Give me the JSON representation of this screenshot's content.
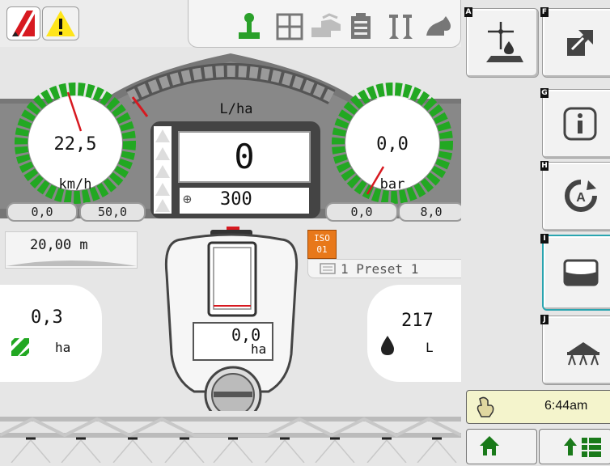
{
  "status_bar": {
    "icons": [
      "alarm-logo-icon",
      "warning-icon",
      "joystick-icon",
      "section-grid-icon",
      "sprayer-icon",
      "clipboard-icon",
      "nozzle-icon",
      "product-icon"
    ]
  },
  "speed_gauge": {
    "value": "22,5",
    "unit": "km/h",
    "min": "0,0",
    "max": "50,0"
  },
  "pressure_gauge": {
    "value": "0,0",
    "unit": "bar",
    "min": "0,0",
    "max": "8,0"
  },
  "rate": {
    "unit": "L/ha",
    "actual": "0",
    "target": "300"
  },
  "boom_width": "20,00 m",
  "iso_badge": {
    "line1": "ISO",
    "line2": "01"
  },
  "preset": "1 Preset 1",
  "area": {
    "value": "0,3",
    "unit": "ha"
  },
  "tank": {
    "value": "217",
    "unit": "L"
  },
  "tank_area": {
    "value": "0,0",
    "unit": "ha"
  },
  "softkeys": [
    {
      "letter": "A",
      "icon": "field-application-icon"
    },
    {
      "letter": "F",
      "icon": "exit-fullscreen-icon"
    },
    {
      "letter": "G",
      "icon": "info-icon"
    },
    {
      "letter": "H",
      "icon": "auto-mode-icon"
    },
    {
      "letter": "I",
      "icon": "tank-icon"
    },
    {
      "letter": "J",
      "icon": "boom-icon"
    }
  ],
  "clock": "6:44am",
  "colors": {
    "gauge_green": "#22a822",
    "accent_red": "#d71920",
    "iso_orange": "#e8781a",
    "key_letter_bg": "#111111"
  }
}
